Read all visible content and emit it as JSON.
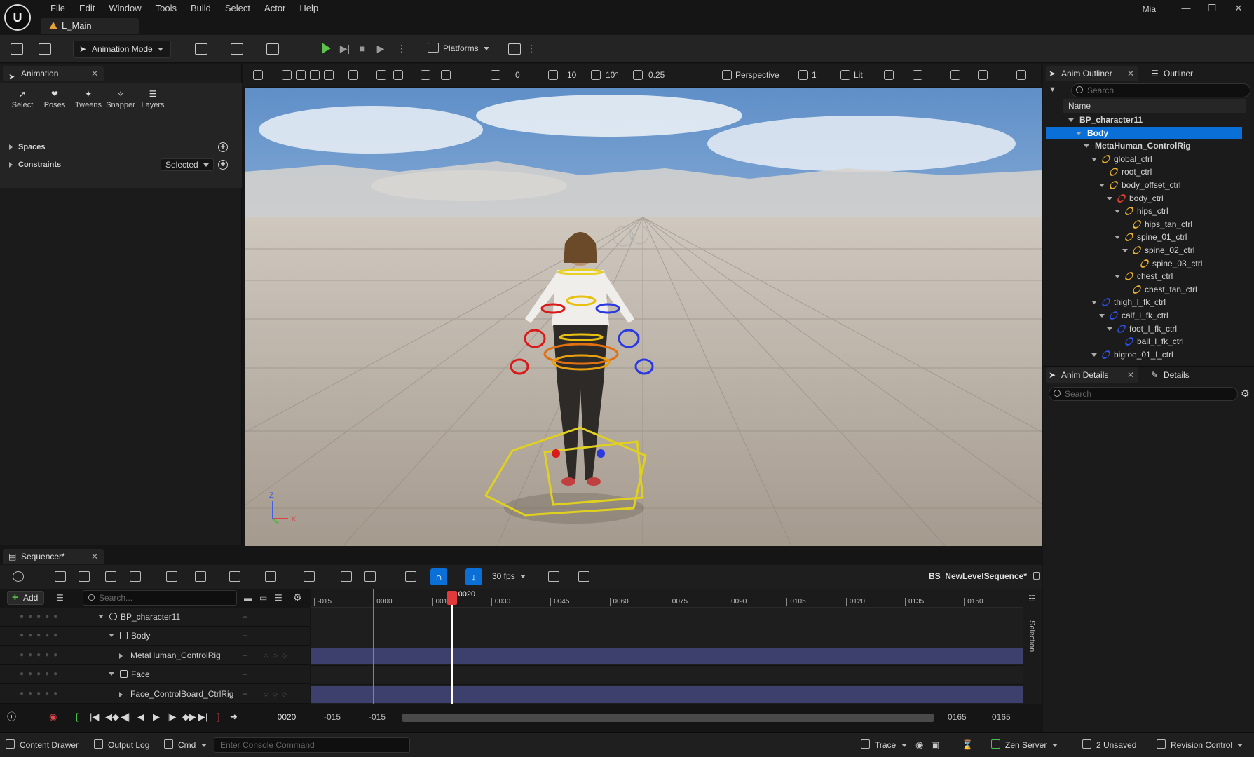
{
  "title_bar": {
    "menu": [
      "File",
      "Edit",
      "Window",
      "Tools",
      "Build",
      "Select",
      "Actor",
      "Help"
    ],
    "level_tab": "L_Main",
    "user": "Mia"
  },
  "toolbar": {
    "mode_label": "Animation Mode",
    "platforms_label": "Platforms"
  },
  "animation_panel": {
    "tab_label": "Animation",
    "modes": [
      "Select",
      "Poses",
      "Tweens",
      "Snapper",
      "Layers"
    ],
    "sections": {
      "spaces": "Spaces",
      "constraints": "Constraints",
      "constraints_filter": "Selected"
    }
  },
  "viewport": {
    "toolbar": {
      "rotation_snap": "0",
      "grid_snap": "10",
      "angle_snap": "10°",
      "scale_snap": "0.25",
      "view_mode": "Perspective",
      "camera_speed": "1",
      "lighting": "Lit"
    },
    "axis_z": "Z",
    "axis_x": "X"
  },
  "anim_outliner": {
    "tab_label": "Anim Outliner",
    "secondary_tab": "Outliner",
    "search_placeholder": "Search",
    "column_name": "Name",
    "items": [
      {
        "label": "BP_character11",
        "depth": 0,
        "expand": true,
        "icon": "none",
        "bold": true
      },
      {
        "label": "Body",
        "depth": 1,
        "expand": true,
        "icon": "none",
        "bold": true,
        "selected": true
      },
      {
        "label": "MetaHuman_ControlRig",
        "depth": 2,
        "expand": true,
        "icon": "none",
        "bold": true
      },
      {
        "label": "global_ctrl",
        "depth": 3,
        "expand": true,
        "icon": "yellow"
      },
      {
        "label": "root_ctrl",
        "depth": 4,
        "expand": false,
        "icon": "yellow"
      },
      {
        "label": "body_offset_ctrl",
        "depth": 4,
        "expand": true,
        "icon": "yellow"
      },
      {
        "label": "body_ctrl",
        "depth": 5,
        "expand": true,
        "icon": "red"
      },
      {
        "label": "hips_ctrl",
        "depth": 6,
        "expand": true,
        "icon": "yellow"
      },
      {
        "label": "hips_tan_ctrl",
        "depth": 7,
        "expand": false,
        "icon": "yellow"
      },
      {
        "label": "spine_01_ctrl",
        "depth": 6,
        "expand": true,
        "icon": "yellow"
      },
      {
        "label": "spine_02_ctrl",
        "depth": 7,
        "expand": true,
        "icon": "yellow"
      },
      {
        "label": "spine_03_ctrl",
        "depth": 8,
        "expand": false,
        "icon": "yellow"
      },
      {
        "label": "chest_ctrl",
        "depth": 6,
        "expand": true,
        "icon": "yellow"
      },
      {
        "label": "chest_tan_ctrl",
        "depth": 7,
        "expand": false,
        "icon": "yellow"
      },
      {
        "label": "thigh_l_fk_ctrl",
        "depth": 3,
        "expand": true,
        "icon": "blue"
      },
      {
        "label": "calf_l_fk_ctrl",
        "depth": 4,
        "expand": true,
        "icon": "blue"
      },
      {
        "label": "foot_l_fk_ctrl",
        "depth": 5,
        "expand": true,
        "icon": "blue"
      },
      {
        "label": "ball_l_fk_ctrl",
        "depth": 6,
        "expand": false,
        "icon": "blue"
      },
      {
        "label": "bigtoe_01_l_ctrl",
        "depth": 3,
        "expand": true,
        "icon": "blue"
      }
    ]
  },
  "anim_details": {
    "tab_label": "Anim Details",
    "secondary_tab": "Details",
    "search_placeholder": "Search"
  },
  "sequencer": {
    "tab_label": "Sequencer*",
    "fps": "30 fps",
    "sequence_name": "BS_NewLevelSequence*",
    "add_label": "Add",
    "search_placeholder": "Search...",
    "tracks": [
      {
        "label": "BP_character11",
        "indent": 0,
        "kind": "actor",
        "expanded": true
      },
      {
        "label": "Body",
        "indent": 1,
        "kind": "skeletal",
        "expanded": true
      },
      {
        "label": "MetaHuman_ControlRig",
        "indent": 2,
        "kind": "rig",
        "expanded": false
      },
      {
        "label": "Face",
        "indent": 1,
        "kind": "skeletal",
        "expanded": true
      },
      {
        "label": "Face_ControlBoard_CtrlRig",
        "indent": 2,
        "kind": "rig",
        "expanded": false
      }
    ],
    "ruler_ticks": [
      "-015",
      "0000",
      "001",
      "0030",
      "0045",
      "0060",
      "0075",
      "0090",
      "0105",
      "0120",
      "0135",
      "0150"
    ],
    "ruler_tick_frames": [
      -15,
      0,
      15,
      30,
      45,
      60,
      75,
      90,
      105,
      120,
      135,
      150
    ],
    "current_frame_label": "0020",
    "current_frame": 20,
    "playback_start_frame": 0,
    "playback_end_frame": 165,
    "transport": {
      "current_frame": "0020",
      "view_start": "-015",
      "work_start": "-015",
      "work_end": "0165",
      "view_end": "0165"
    },
    "side_label": "Selection"
  },
  "status_bar": {
    "content_drawer": "Content Drawer",
    "output_log": "Output Log",
    "cmd": "Cmd",
    "console_placeholder": "Enter Console Command",
    "trace": "Trace",
    "zen_server": "Zen Server",
    "unsaved": "2 Unsaved",
    "revision_control": "Revision Control"
  },
  "colors": {
    "accent_blue": "#0a6fd6",
    "play_green": "#5cc24c",
    "playhead_red": "#e23a3a",
    "track_bar": "#3d3f6c",
    "ctrl_yellow": "#e8b030",
    "ctrl_red": "#e04030",
    "ctrl_blue": "#3050e0"
  }
}
